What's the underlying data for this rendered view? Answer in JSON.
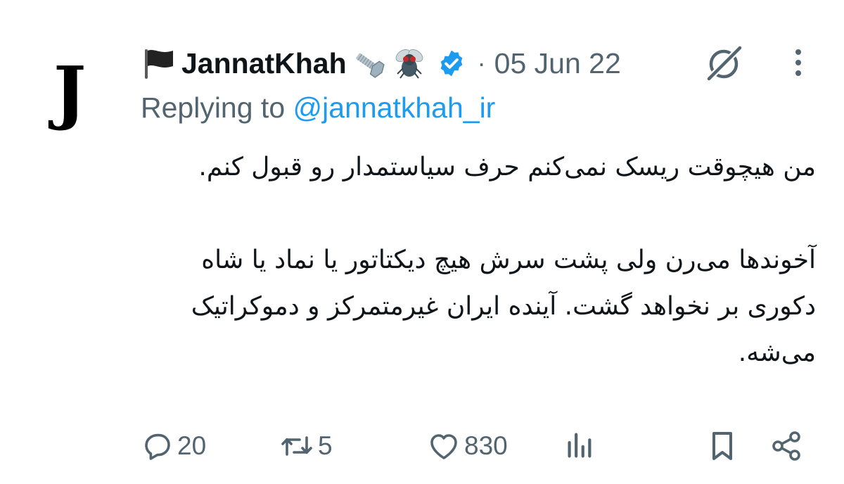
{
  "author": {
    "avatar_letter": "J",
    "display_name": "JannatKhah",
    "date": "05 Jun 22",
    "separator": "·"
  },
  "reply": {
    "prefix": "Replying to",
    "handle": "@jannatkhah_ir"
  },
  "tweet": {
    "paragraph_1": "من هیچوقت ریسک نمی‌کنم حرف سیاستمدار رو قبول کنم.",
    "paragraph_2": "آخوندها می‌رن ولی پشت سرش هیچ دیکتاتور یا نماد یا شاه دکوری بر نخواهد گشت. آینده ایران غیرمتمرکز و دموکراتیک می‌شه."
  },
  "actions": {
    "replies": "20",
    "retweets": "5",
    "likes": "830"
  },
  "icons": {
    "flag": "black-flag-icon",
    "bolt": "nut-and-bolt-icon",
    "fly": "fly-icon",
    "verified": "verified-badge-icon",
    "grok": "grok-icon",
    "more": "more-vertical-icon",
    "reply": "reply-icon",
    "retweet": "retweet-icon",
    "like": "heart-icon",
    "views": "views-chart-icon",
    "bookmark": "bookmark-icon",
    "share": "share-icon"
  },
  "colors": {
    "text": "#0f1419",
    "secondary": "#536471",
    "link": "#1d9bf0",
    "verified": "#1d9bf0"
  }
}
